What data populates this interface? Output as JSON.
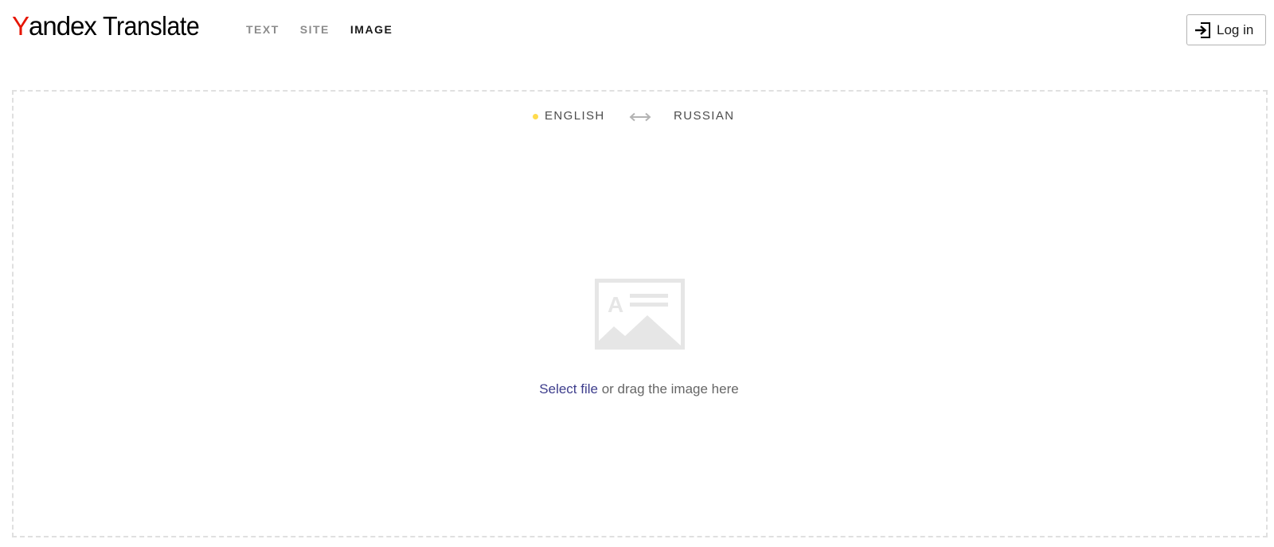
{
  "app": {
    "logo_first_letter": "Y",
    "logo_brand_rest": "andex",
    "logo_product": "Translate"
  },
  "nav": {
    "tabs": [
      {
        "label": "TEXT",
        "active": false
      },
      {
        "label": "SITE",
        "active": false
      },
      {
        "label": "IMAGE",
        "active": true
      }
    ]
  },
  "header": {
    "login_label": "Log in",
    "login_icon": "login-arrow-icon"
  },
  "languages": {
    "source": "ENGLISH",
    "target": "RUSSIAN",
    "swap_icon": "swap-arrows-icon",
    "indicator_color": "#ffdb4d"
  },
  "dropzone": {
    "icon": "image-text-icon",
    "select_file_label": "Select file",
    "drag_text": " or drag the image here"
  },
  "colors": {
    "brand_red": "#e61400",
    "link": "#3d3d8c",
    "muted_text": "#666666",
    "border": "#e0e0e0"
  }
}
